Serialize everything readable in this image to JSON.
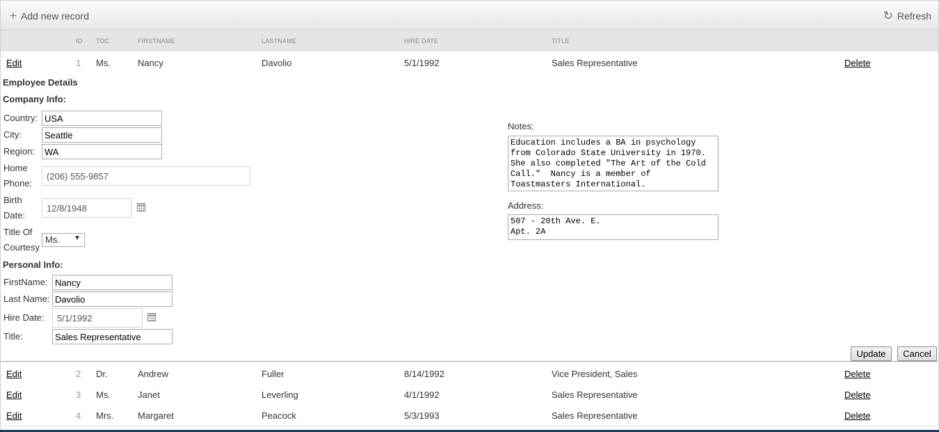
{
  "toolbar": {
    "add_label": "Add new record",
    "add_icon": "plus-icon",
    "refresh_label": "Refresh",
    "refresh_icon": "refresh-icon"
  },
  "columns": {
    "id": "ID",
    "toc": "TOC",
    "firstname": "FIRSTNAME",
    "lastname": "LASTNAME",
    "hire_date": "HIRE DATE",
    "title": "TITLE"
  },
  "actions": {
    "edit": "Edit",
    "delete": "Delete"
  },
  "rows": [
    {
      "id": "1",
      "toc": "Ms.",
      "firstname": "Nancy",
      "lastname": "Davolio",
      "hire_date": "5/1/1992",
      "title": "Sales Representative"
    },
    {
      "id": "2",
      "toc": "Dr.",
      "firstname": "Andrew",
      "lastname": "Fuller",
      "hire_date": "8/14/1992",
      "title": "Vice President, Sales"
    },
    {
      "id": "3",
      "toc": "Ms.",
      "firstname": "Janet",
      "lastname": "Leverling",
      "hire_date": "4/1/1992",
      "title": "Sales Representative"
    },
    {
      "id": "4",
      "toc": "Mrs.",
      "firstname": "Margaret",
      "lastname": "Peacock",
      "hire_date": "5/3/1993",
      "title": "Sales Representative"
    }
  ],
  "form": {
    "heading": "Employee Details",
    "company_heading": "Company Info:",
    "personal_heading": "Personal Info:",
    "labels": {
      "country": "Country:",
      "city": "City:",
      "region": "Region:",
      "home": "Home",
      "phone": "Phone:",
      "birth": "Birth",
      "date": "Date:",
      "title_of": "Title Of",
      "courtesy": "Courtesy",
      "firstname": "FirstName:",
      "lastname": "Last Name:",
      "hire_date": "Hire Date:",
      "title": "Title:",
      "notes": "Notes:",
      "address": "Address:"
    },
    "values": {
      "country": "USA",
      "city": "Seattle",
      "region": "WA",
      "home_phone": "(206) 555-9857",
      "birth_date": "12/8/1948",
      "title_of_courtesy": "Ms.",
      "firstname": "Nancy",
      "lastname": "Davolio",
      "hire_date": "5/1/1992",
      "title": "Sales Representative",
      "notes": "Education includes a BA in psychology\nfrom Colorado State University in 1970.\nShe also completed \"The Art of the Cold\nCall.\"  Nancy is a member of\nToastmasters International.",
      "address": "507 - 20th Ave. E.\nApt. 2A"
    },
    "update_label": "Update",
    "cancel_label": "Cancel"
  }
}
